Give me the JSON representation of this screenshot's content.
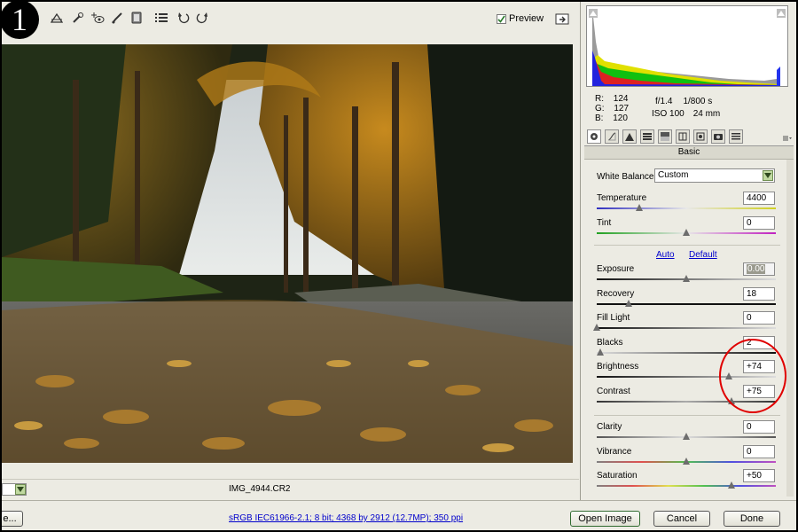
{
  "step_number": "1",
  "toolbar": {
    "preview_label": "Preview",
    "preview_checked": true,
    "tools": [
      "zoom-icon",
      "hand-icon",
      "white-balance-icon",
      "color-sampler-icon",
      "crop-icon",
      "straighten-icon",
      "retouch-icon",
      "red-eye-icon",
      "brush-icon",
      "graduated-filter-icon",
      "preferences-icon",
      "rotate-left-icon",
      "rotate-right-icon"
    ]
  },
  "image": {
    "filename": "IMG_4944.CR2"
  },
  "info": {
    "r_label": "R:",
    "r_value": "124",
    "g_label": "G:",
    "g_value": "127",
    "b_label": "B:",
    "b_value": "120",
    "aperture": "f/1.4",
    "shutter": "1/800 s",
    "iso": "ISO 100",
    "focal": "24 mm"
  },
  "section_title": "Basic",
  "white_balance": {
    "label": "White Balance:",
    "value": "Custom"
  },
  "links": {
    "auto": "Auto",
    "default": "Default"
  },
  "controls": [
    {
      "name": "temperature",
      "label": "Temperature",
      "value": "4400",
      "level": 0.24
    },
    {
      "name": "tint",
      "label": "Tint",
      "value": "0",
      "level": 0.5
    },
    {
      "name": "exposure",
      "label": "Exposure",
      "value": "0.00",
      "level": 0.5
    },
    {
      "name": "recovery",
      "label": "Recovery",
      "value": "18",
      "level": 0.18
    },
    {
      "name": "fill-light",
      "label": "Fill Light",
      "value": "0",
      "level": 0.0
    },
    {
      "name": "blacks",
      "label": "Blacks",
      "value": "2",
      "level": 0.02
    },
    {
      "name": "brightness",
      "label": "Brightness",
      "value": "+74",
      "level": 0.74
    },
    {
      "name": "contrast",
      "label": "Contrast",
      "value": "+75",
      "level": 0.75
    },
    {
      "name": "clarity",
      "label": "Clarity",
      "value": "0",
      "level": 0.5
    },
    {
      "name": "vibrance",
      "label": "Vibrance",
      "value": "0",
      "level": 0.5
    },
    {
      "name": "saturation",
      "label": "Saturation",
      "value": "+50",
      "level": 0.75
    }
  ],
  "bottom": {
    "save_label": "e...",
    "workflow_info": "sRGB IEC61966-2.1; 8 bit; 4368 by 2912 (12.7MP); 350 ppi",
    "open_label": "Open Image",
    "cancel_label": "Cancel",
    "done_label": "Done"
  },
  "colors": {
    "annotation": "#e00000",
    "panel_bg": "#ecebe3",
    "link": "#0000cc"
  }
}
